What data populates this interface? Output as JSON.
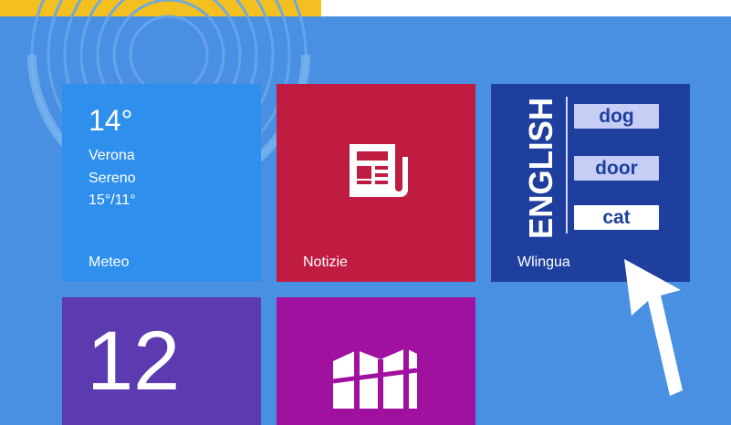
{
  "weather_tile": {
    "temperature": "14°",
    "city": "Verona",
    "condition": "Sereno",
    "range": "15°/11°",
    "label": "Meteo"
  },
  "news_tile": {
    "label": "Notizie",
    "icon": "newspaper-icon"
  },
  "wlingua_tile": {
    "vertical_text": "ENGLISH",
    "words": [
      "dog",
      "door",
      "cat"
    ],
    "label": "Wlingua"
  },
  "calendar_tile": {
    "day": "12"
  },
  "maps_tile": {
    "icon": "map-icon"
  },
  "colors": {
    "background": "#4a90e2",
    "meteo": "#2f8fec",
    "notizie": "#c01b41",
    "wlingua": "#1e3f9e",
    "calendar": "#5c3bb1",
    "maps": "#a0119f",
    "top_accent": "#f4c020"
  }
}
